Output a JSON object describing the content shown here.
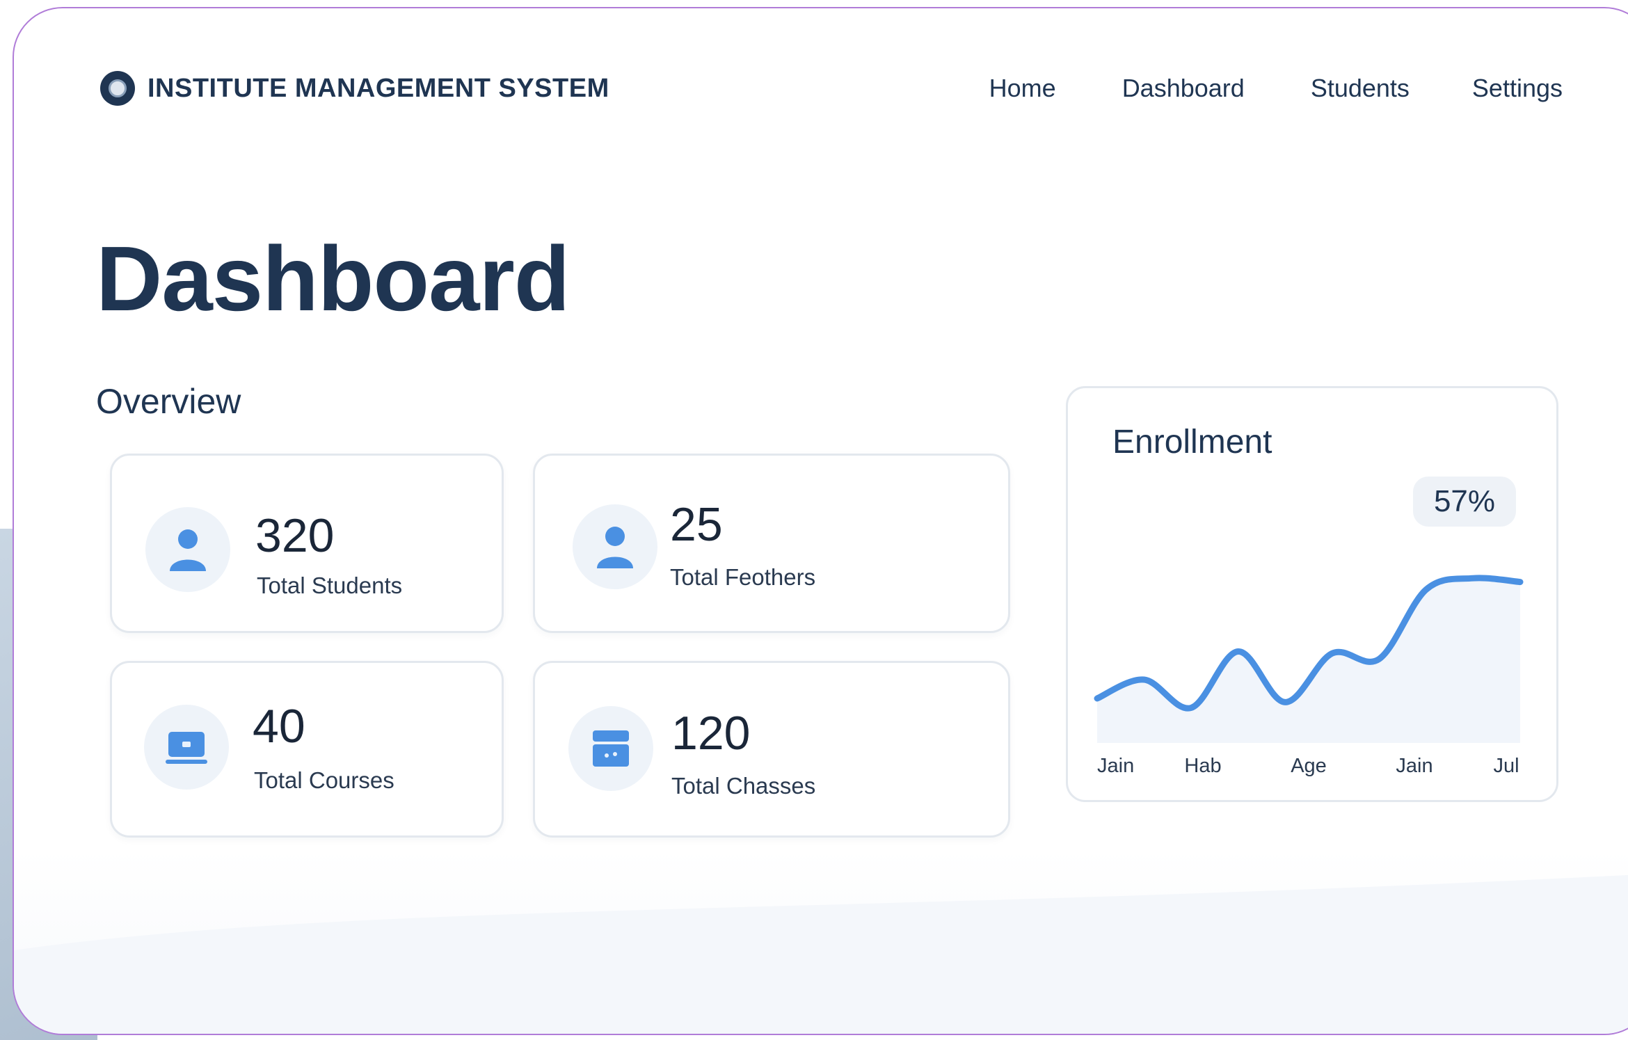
{
  "app": {
    "brand_name": "INSTITUTE MANAGEMENT SYSTEM"
  },
  "nav": {
    "items": [
      {
        "label": "Home"
      },
      {
        "label": "Dashboard"
      },
      {
        "label": "Students"
      },
      {
        "label": "Settings"
      }
    ]
  },
  "page": {
    "title": "Dashboard",
    "section_title": "Overview"
  },
  "stats": [
    {
      "value": "320",
      "label": "Total Students",
      "icon": "user-icon"
    },
    {
      "value": "25",
      "label": "Total Feothers",
      "icon": "user-icon"
    },
    {
      "value": "40",
      "label": "Total Courses",
      "icon": "laptop-icon"
    },
    {
      "value": "120",
      "label": "Total Chasses",
      "icon": "classroom-icon"
    }
  ],
  "colors": {
    "primary": "#1f3552",
    "accent": "#4a90e2",
    "card_border": "#e3e8ee",
    "frame_border": "#b07cd8"
  },
  "chart_data": {
    "type": "area",
    "title": "Enrollment",
    "badge": "57%",
    "categories": [
      "Jain",
      "Hab",
      "Age",
      "Jain",
      "Jul"
    ],
    "series": [
      {
        "x": [
          0,
          0.5,
          1,
          1.5,
          2,
          2.5,
          3,
          3.5,
          4,
          4.5
        ],
        "values": [
          0.2,
          0.3,
          0.15,
          0.45,
          0.18,
          0.44,
          0.41,
          0.78,
          0.84,
          0.82
        ]
      }
    ],
    "grid": false
  }
}
